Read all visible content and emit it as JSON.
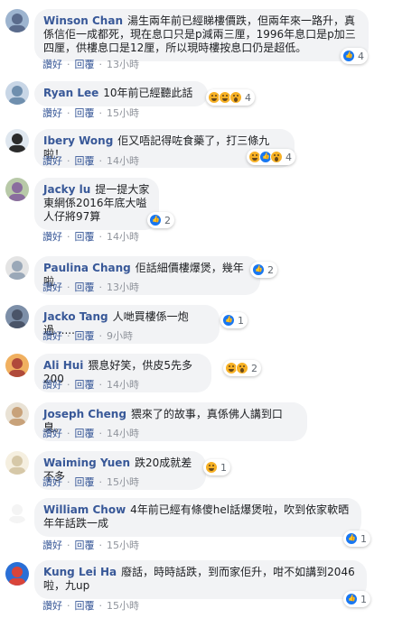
{
  "actions": {
    "like": "讚好",
    "reply": "回覆"
  },
  "comments": [
    {
      "author": "Winson Chan",
      "text": "湯生兩年前已經睇樓價跌，但兩年來一路升，真係信佢一成都死，現在息口只是p減兩三厘，1996年息口是p加三四厘，供樓息口是12厘，所以現時樓按息口仍是超低。",
      "time": "13小時",
      "reactions": [
        "like"
      ],
      "count": "4",
      "avatar_color": "#5a6b8c"
    },
    {
      "author": "Ryan Lee",
      "text": "10年前已經聽此話",
      "time": "15小時",
      "reactions": [
        "haha",
        "haha",
        "wow"
      ],
      "count": "4",
      "avatar_color": "#6f8fae"
    },
    {
      "author": "Ibery Wong",
      "text": "佢又唔記得咗食藥了，打三條九啦！",
      "time": "14小時",
      "reactions": [
        "haha",
        "like",
        "wow"
      ],
      "count": "4",
      "avatar_color": "#2b2b2b"
    },
    {
      "author": "Jacky lu",
      "text": "提一提大家 東網係2016年底大嗌人仔將97算",
      "time": "14小時",
      "reactions": [
        "like"
      ],
      "count": "2",
      "avatar_color": "#8a6d9e"
    },
    {
      "author": "Paulina Chang",
      "text": "佢話細價樓爆煲，幾年啦",
      "time": "13小時",
      "reactions": [
        "like"
      ],
      "count": "2",
      "avatar_color": "#9aa8b8"
    },
    {
      "author": "Jacko Tang",
      "text": "人哋買樓係一炮過......",
      "time": "9小時",
      "reactions": [
        "like"
      ],
      "count": "1",
      "avatar_color": "#4a5468"
    },
    {
      "author": "Ali Hui",
      "text": "猥息好笑，供皮5先多200",
      "time": "14小時",
      "reactions": [
        "haha",
        "wow"
      ],
      "count": "2",
      "avatar_color": "#b04a3a"
    },
    {
      "author": "Joseph Cheng",
      "text": "猥來了的故事，真係佛人講到口臭。",
      "time": "14小時",
      "reactions": [],
      "count": "",
      "avatar_color": "#c8a27a"
    },
    {
      "author": "Waiming Yuen",
      "text": "跌20成就差不多",
      "time": "15小時",
      "reactions": [
        "haha"
      ],
      "count": "1",
      "avatar_color": "#d6c8a8"
    },
    {
      "author": "William Chow",
      "text": "4年前已經有條傻hel話爆煲啦，吹到依家軟晒年年話跌一成",
      "time": "15小時",
      "reactions": [
        "like"
      ],
      "count": "1",
      "avatar_color": "#f4f4f4"
    },
    {
      "author": "Kung Lei Ha",
      "text": "廢話，時時話跌，到而家佢升，咁不如講到2046啦，九up",
      "time": "15小時",
      "reactions": [
        "like"
      ],
      "count": "1",
      "avatar_color": "#d9443a"
    }
  ]
}
